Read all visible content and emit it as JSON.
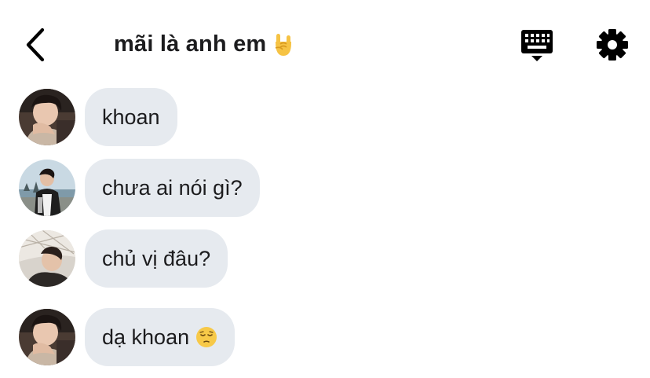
{
  "header": {
    "back_icon": "chevron-left-icon",
    "title": "mãi là anh em",
    "title_emoji": "rock-on-hand-icon",
    "keyboard_icon": "keyboard-icon",
    "settings_icon": "gear-icon"
  },
  "messages": [
    {
      "text": "khoan",
      "avatar": "avatar-photo-1",
      "emoji": null
    },
    {
      "text": "chưa ai nói gì?",
      "avatar": "avatar-photo-2",
      "emoji": null
    },
    {
      "text": "chủ vị đâu?",
      "avatar": "avatar-photo-3",
      "emoji": null
    },
    {
      "text": "dạ khoan",
      "avatar": "avatar-photo-1",
      "emoji": "pensive-face-icon"
    }
  ],
  "colors": {
    "bubble": "#e6eaef",
    "text": "#1c1c1e",
    "icon": "#000000",
    "background": "#ffffff"
  }
}
